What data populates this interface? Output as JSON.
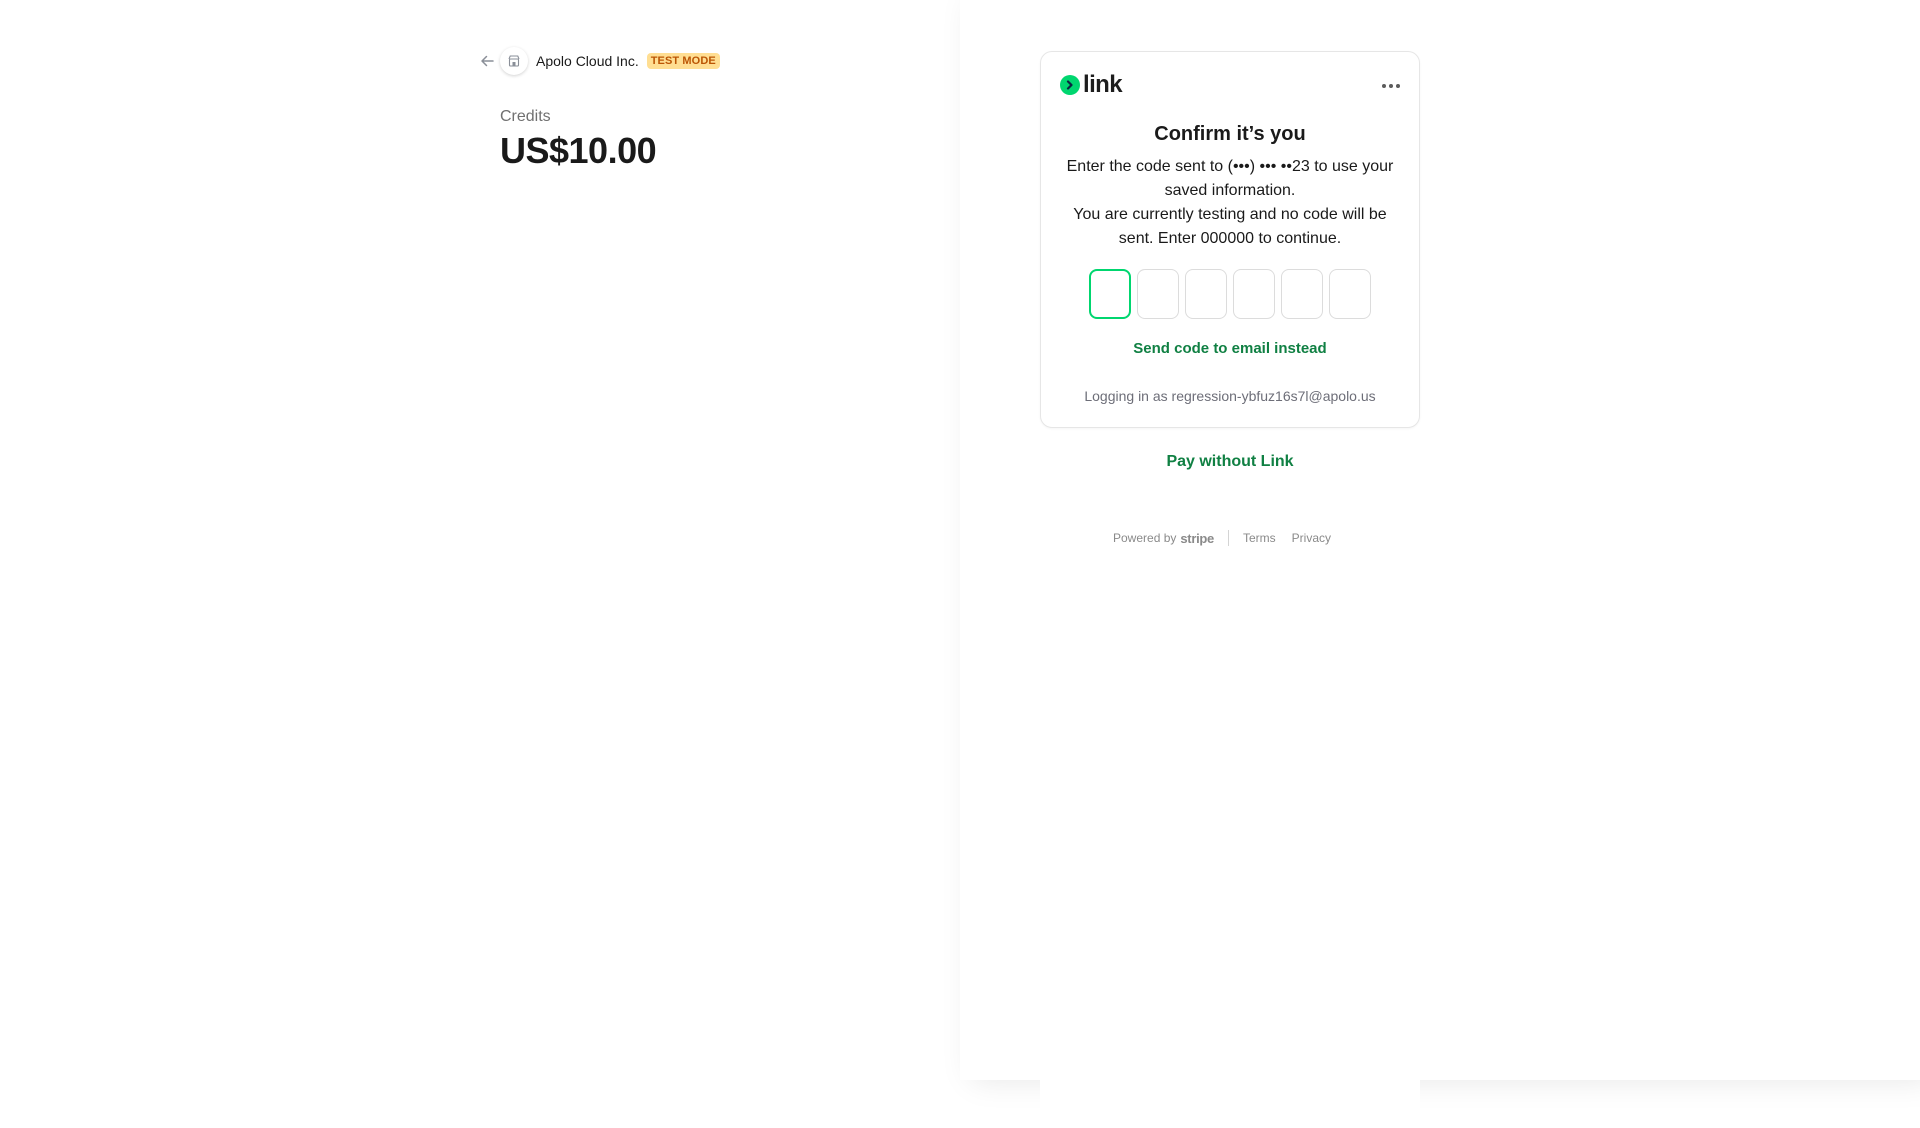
{
  "merchant": {
    "name": "Apolo Cloud Inc.",
    "badge": "TEST MODE",
    "back_icon": "arrow-left-icon",
    "store_icon": "store-icon"
  },
  "product": {
    "label": "Credits",
    "price": "US$10.00"
  },
  "link_card": {
    "logo_text": "link",
    "more_icon": "more-horizontal-icon",
    "title": "Confirm it’s you",
    "description_line1": "Enter the code sent to (•••) ••• ••23 to use your saved information.",
    "description_line2": "You are currently testing and no code will be sent. Enter 000000 to continue.",
    "otp_values": [
      "",
      "",
      "",
      "",
      "",
      ""
    ],
    "send_email_label": "Send code to email instead",
    "logging_in_as": "Logging in as regression-ybfuz16s7l@apolo.us"
  },
  "pay_without_link_label": "Pay without Link",
  "footer": {
    "powered_by": "Powered by",
    "stripe": "stripe",
    "terms": "Terms",
    "privacy": "Privacy"
  },
  "colors": {
    "accent_green": "#00d66f",
    "link_green": "#108043",
    "badge_bg": "#ffde92",
    "badge_text": "#bb5504"
  }
}
